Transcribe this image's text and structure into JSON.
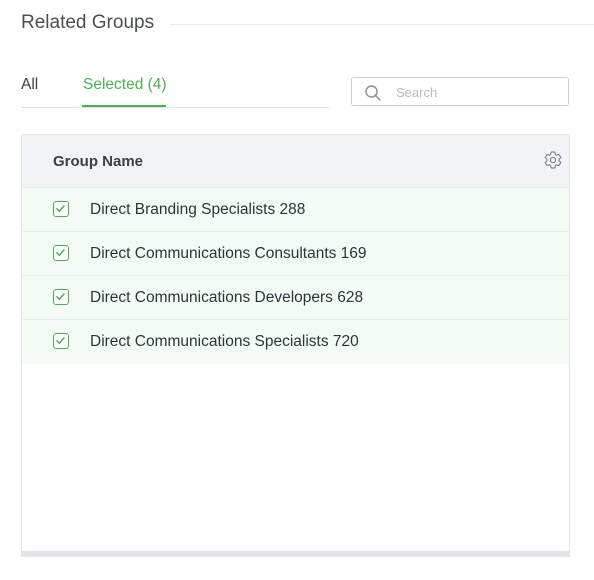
{
  "section": {
    "title": "Related Groups"
  },
  "tabs": [
    {
      "label": "All",
      "active": false
    },
    {
      "label": "Selected (4)",
      "active": true
    }
  ],
  "search": {
    "placeholder": "Search",
    "value": "",
    "icon": "search-icon"
  },
  "table": {
    "column_header": "Group Name",
    "settings_icon": "gear-icon",
    "rows": [
      {
        "label": "Direct Branding Specialists 288",
        "checked": true
      },
      {
        "label": "Direct Communications Consultants 169",
        "checked": true
      },
      {
        "label": "Direct Communications Developers 628",
        "checked": true
      },
      {
        "label": "Direct Communications Specialists 720",
        "checked": true
      }
    ]
  },
  "colors": {
    "accent": "#4caf50",
    "header_bg": "#f1f3f6",
    "selected_row_bg": "#f4faf4"
  }
}
